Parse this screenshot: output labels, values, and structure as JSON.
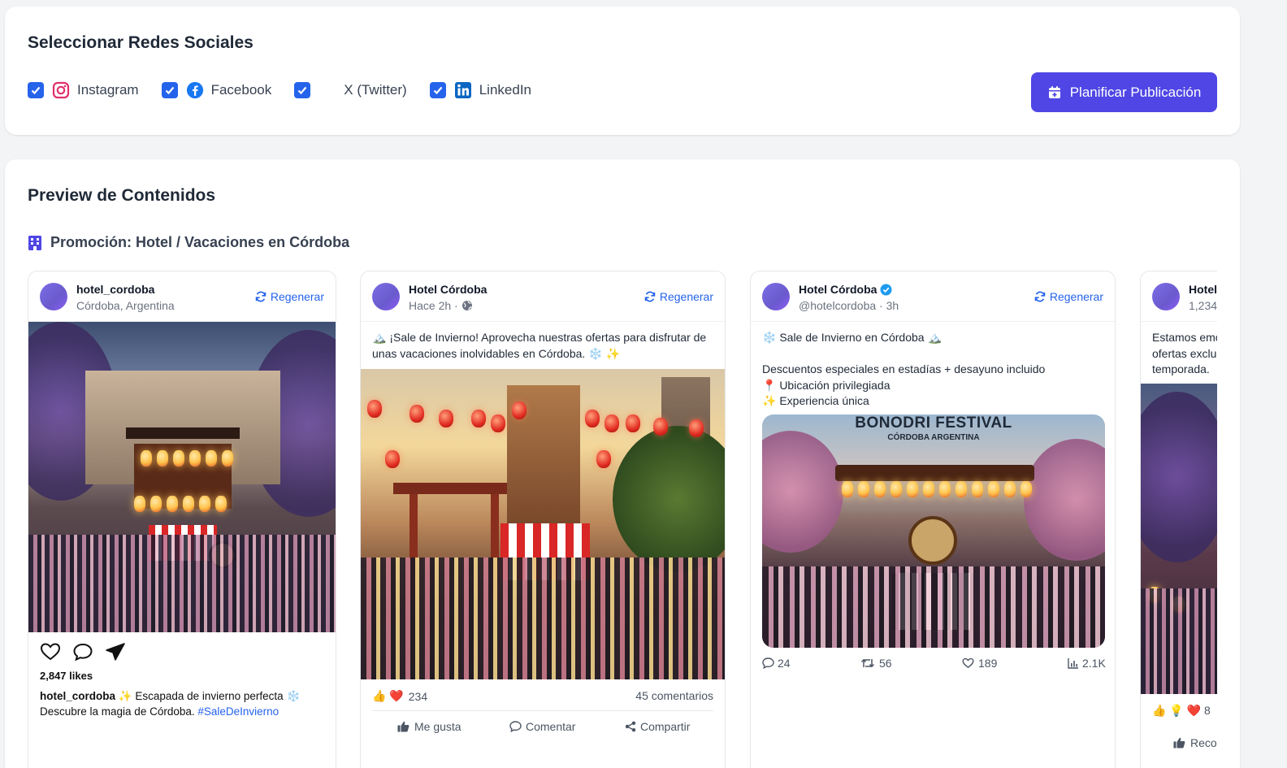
{
  "social": {
    "title": "Seleccionar Redes Sociales",
    "networks": [
      {
        "label": "Instagram",
        "checked": true,
        "icon": "instagram-icon",
        "color": "#e1306c"
      },
      {
        "label": "Facebook",
        "checked": true,
        "icon": "facebook-icon",
        "color": "#1877f2"
      },
      {
        "label": "X (Twitter)",
        "checked": true,
        "icon": "x-icon",
        "color": "#111827"
      },
      {
        "label": "LinkedIn",
        "checked": true,
        "icon": "linkedin-icon",
        "color": "#0a66c2"
      }
    ],
    "plan_button": "Planificar Publicación",
    "plan_icon": "calendar-plus-icon",
    "accent": "#4f46e5"
  },
  "preview": {
    "title": "Preview de Contenidos",
    "promo_label": "Promoción: Hotel / Vacaciones en Córdoba",
    "promo_icon": "hotel-icon",
    "regenerate_label": "Regenerar",
    "posts": {
      "instagram": {
        "username": "hotel_cordoba",
        "location": "Córdoba, Argentina",
        "likes": "2,847 likes",
        "caption_user": "hotel_cordoba",
        "caption_text": " ✨ Escapada de invierno perfecta ❄️ Descubre la magia de Córdoba. ",
        "hashtag": "#SaleDeInvierno"
      },
      "facebook": {
        "name": "Hotel Córdoba",
        "time": "Hace 2h ·",
        "text": "🏔️ ¡Sale de Invierno! Aprovecha nuestras ofertas para disfrutar de unas vacaciones inolvidables en Córdoba. ❄️ ✨",
        "reactions_emoji": "👍 ❤️",
        "reactions_count": "234",
        "comments": "45 comentarios",
        "actions": [
          "Me gusta",
          "Comentar",
          "Compartir"
        ]
      },
      "twitter": {
        "name": "Hotel Córdoba",
        "handle": "@hotelcordoba · 3h",
        "text": "❄️ Sale de Invierno en Córdoba 🏔️\n\nDescuentos especiales en estadías + desayuno incluido\n📍 Ubicación privilegiada\n✨ Experiencia única",
        "image_title": "BONODRI FESTIVAL",
        "image_subtitle": "CÓRDOBA ARGENTINA",
        "replies": "24",
        "retweets": "56",
        "likes": "189",
        "views": "2.1K"
      },
      "linkedin": {
        "name": "Hotel",
        "followers": "1,234",
        "text": "Estamos emo\nofertas exclu\ntemporada. ",
        "reactions": "👍 💡 ❤️ 8",
        "action": "Recor"
      }
    }
  }
}
